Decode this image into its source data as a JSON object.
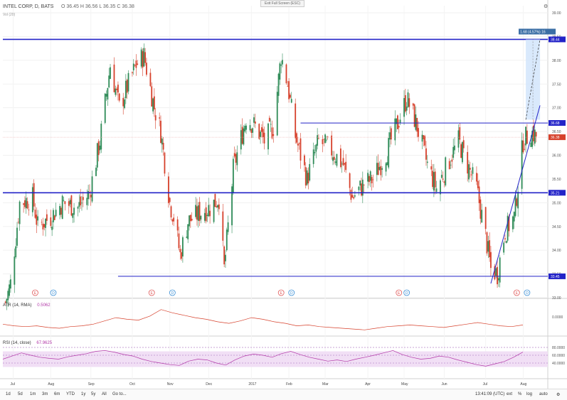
{
  "header": {
    "symbol": "INTEL CORP, D, BATS",
    "ohlc": "O 36.45 H 36.56 L 36.35 C 36.38",
    "volume_label": "Vol (20)",
    "exit_fullscreen": "Exit Full Screen (ESC)"
  },
  "colors": {
    "up": "#2e8b57",
    "down": "#d6402b",
    "line": "#2323c8",
    "projection_fill": "#cfe3fb",
    "indicator": "#b238a8",
    "rsi_band": "#f1dff5"
  },
  "price_axis": {
    "ticks": [
      "39.00",
      "38.50",
      "38.00",
      "37.50",
      "37.00",
      "36.50",
      "36.00",
      "35.50",
      "35.00",
      "34.50",
      "34.00",
      "33.50",
      "33.00"
    ],
    "tags": [
      {
        "label": "38.44",
        "color": "#2323c8"
      },
      {
        "label": "36.68",
        "color": "#2323c8"
      },
      {
        "label": "36.38",
        "color": "#d6402b"
      },
      {
        "label": "35.21",
        "color": "#2323c8"
      },
      {
        "label": "33.45",
        "color": "#2323c8"
      }
    ]
  },
  "projection_label": "1.68 (4.57%) 16",
  "atr": {
    "label": "ATR (14, RMA)",
    "value": "0.5062",
    "axis_tick": "0.0000"
  },
  "rsi": {
    "label": "RSI (14, close)",
    "value": "67.9625",
    "axis_ticks": [
      "80.0000",
      "60.0000",
      "40.0000"
    ]
  },
  "time_axis": [
    "Jul",
    "Aug",
    "Sep",
    "Oct",
    "Nov",
    "Dec",
    "2017",
    "Feb",
    "Mar",
    "Apr",
    "May",
    "Jun",
    "Jul",
    "Aug"
  ],
  "bottom_bar": {
    "ranges": [
      "1d",
      "5d",
      "1m",
      "3m",
      "6m",
      "YTD",
      "1y",
      "5y",
      "All",
      "Go to..."
    ],
    "clock": "13:41:09 (UTC)",
    "options": [
      "ext",
      "%",
      "log",
      "auto"
    ]
  },
  "chart_data": {
    "type": "candlestick",
    "symbol": "INTEL CORP",
    "interval": "D",
    "last_close": 36.38,
    "ylim": [
      32.9,
      39.2
    ],
    "x_range": [
      "2016-06-25",
      "2017-08-20"
    ],
    "horizontal_levels": [
      38.44,
      36.68,
      35.21,
      33.45
    ],
    "trendline": {
      "from": [
        "2017-07-07",
        33.3
      ],
      "to": [
        "2017-08-14",
        37.05
      ]
    },
    "projection": {
      "from": [
        "2017-08-03",
        36.75
      ],
      "to": [
        "2017-08-14",
        38.44
      ],
      "change": "1.68 (4.57%)"
    },
    "trend_points": [
      [
        "2016-06-27",
        32.9
      ],
      [
        "2016-07-01",
        33.3
      ],
      [
        "2016-07-08",
        35.0
      ],
      [
        "2016-07-18",
        35.1
      ],
      [
        "2016-07-22",
        34.5
      ],
      [
        "2016-08-01",
        34.7
      ],
      [
        "2016-08-10",
        35.0
      ],
      [
        "2016-08-22",
        34.9
      ],
      [
        "2016-08-31",
        35.2
      ],
      [
        "2016-09-08",
        36.3
      ],
      [
        "2016-09-16",
        37.9
      ],
      [
        "2016-09-23",
        37.0
      ],
      [
        "2016-09-30",
        37.5
      ],
      [
        "2016-10-06",
        37.9
      ],
      [
        "2016-10-12",
        38.1
      ],
      [
        "2016-10-20",
        37.0
      ],
      [
        "2016-10-25",
        36.5
      ],
      [
        "2016-11-01",
        35.0
      ],
      [
        "2016-11-04",
        34.7
      ],
      [
        "2016-11-09",
        33.9
      ],
      [
        "2016-11-15",
        34.6
      ],
      [
        "2016-11-25",
        34.8
      ],
      [
        "2016-12-02",
        34.9
      ],
      [
        "2016-12-09",
        35.1
      ],
      [
        "2016-12-13",
        33.6
      ],
      [
        "2016-12-20",
        35.7
      ],
      [
        "2016-12-30",
        36.8
      ],
      [
        "2017-01-06",
        36.6
      ],
      [
        "2017-01-13",
        36.3
      ],
      [
        "2017-01-20",
        36.6
      ],
      [
        "2017-01-26",
        38.1
      ],
      [
        "2017-01-31",
        37.5
      ],
      [
        "2017-02-06",
        36.4
      ],
      [
        "2017-02-15",
        35.5
      ],
      [
        "2017-02-24",
        36.3
      ],
      [
        "2017-03-06",
        36.1
      ],
      [
        "2017-03-15",
        35.8
      ],
      [
        "2017-03-22",
        35.1
      ],
      [
        "2017-03-31",
        35.4
      ],
      [
        "2017-04-07",
        35.5
      ],
      [
        "2017-04-18",
        36.1
      ],
      [
        "2017-04-25",
        36.6
      ],
      [
        "2017-05-03",
        37.2
      ],
      [
        "2017-05-10",
        36.7
      ],
      [
        "2017-05-19",
        35.8
      ],
      [
        "2017-05-26",
        35.3
      ],
      [
        "2017-06-05",
        35.9
      ],
      [
        "2017-06-12",
        36.3
      ],
      [
        "2017-06-19",
        35.8
      ],
      [
        "2017-06-26",
        35.3
      ],
      [
        "2017-07-03",
        34.3
      ],
      [
        "2017-07-07",
        33.6
      ],
      [
        "2017-07-12",
        33.5
      ],
      [
        "2017-07-18",
        34.4
      ],
      [
        "2017-07-25",
        34.7
      ],
      [
        "2017-08-01",
        36.3
      ],
      [
        "2017-08-07",
        36.5
      ],
      [
        "2017-08-11",
        36.4
      ]
    ],
    "atr_points": [
      0.52,
      0.5,
      0.49,
      0.5,
      0.48,
      0.47,
      0.49,
      0.5,
      0.52,
      0.56,
      0.6,
      0.58,
      0.57,
      0.62,
      0.7,
      0.66,
      0.63,
      0.6,
      0.58,
      0.55,
      0.53,
      0.56,
      0.6,
      0.58,
      0.55,
      0.53,
      0.5,
      0.51,
      0.49,
      0.48,
      0.47,
      0.46,
      0.45,
      0.47,
      0.49,
      0.5,
      0.51,
      0.5,
      0.49,
      0.48,
      0.5,
      0.52,
      0.54,
      0.52,
      0.5,
      0.49,
      0.51
    ],
    "rsi_points": [
      50,
      58,
      66,
      60,
      55,
      52,
      50,
      56,
      60,
      64,
      70,
      72,
      68,
      62,
      58,
      50,
      44,
      40,
      36,
      34,
      45,
      50,
      48,
      40,
      35,
      48,
      58,
      63,
      60,
      55,
      64,
      70,
      62,
      55,
      50,
      45,
      48,
      44,
      50,
      55,
      60,
      66,
      72,
      62,
      55,
      50,
      52,
      58,
      55,
      48,
      42,
      36,
      32,
      38,
      44,
      55,
      68
    ]
  }
}
